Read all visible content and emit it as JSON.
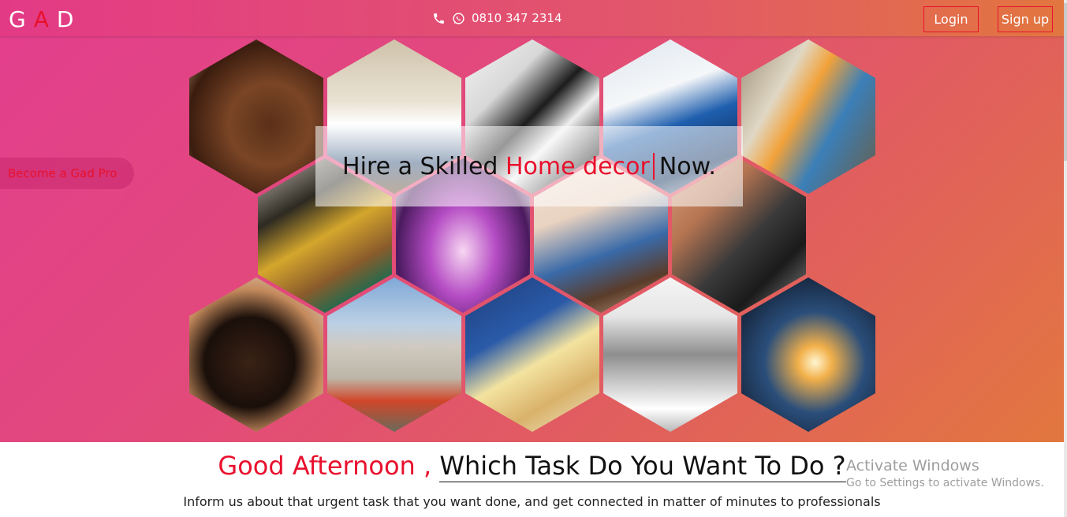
{
  "header": {
    "logo_g": "G",
    "logo_a": "A",
    "logo_d": "D",
    "phone": "0810 347 2314",
    "login_label": "Login",
    "signup_label": "Sign up"
  },
  "sidebar": {
    "pro_label": "Become a Gad Pro"
  },
  "hero": {
    "headline_prefix": "Hire a Skilled",
    "headline_highlight": "Home decor",
    "headline_suffix": "Now."
  },
  "tiles": [
    "makeup-artist",
    "plumber",
    "gadgets",
    "ac-technician",
    "electrician",
    "fashion-designer",
    "event-decor",
    "cleaner",
    "mechanic",
    "hair-stylist",
    "bricklayer",
    "painter",
    "wallpaper",
    "welder"
  ],
  "content": {
    "greeting": "Good Afternoon ,",
    "question": "Which Task Do You Want To Do ?",
    "subtext": "Inform us about that urgent task that you want done, and get connected in matter of minutes to professionals"
  },
  "watermark": {
    "line1": "Activate Windows",
    "line2": "Go to Settings to activate Windows."
  },
  "colors": {
    "accent": "#e8112d",
    "hero_start": "#e33e8e",
    "hero_end": "#e2773f"
  }
}
